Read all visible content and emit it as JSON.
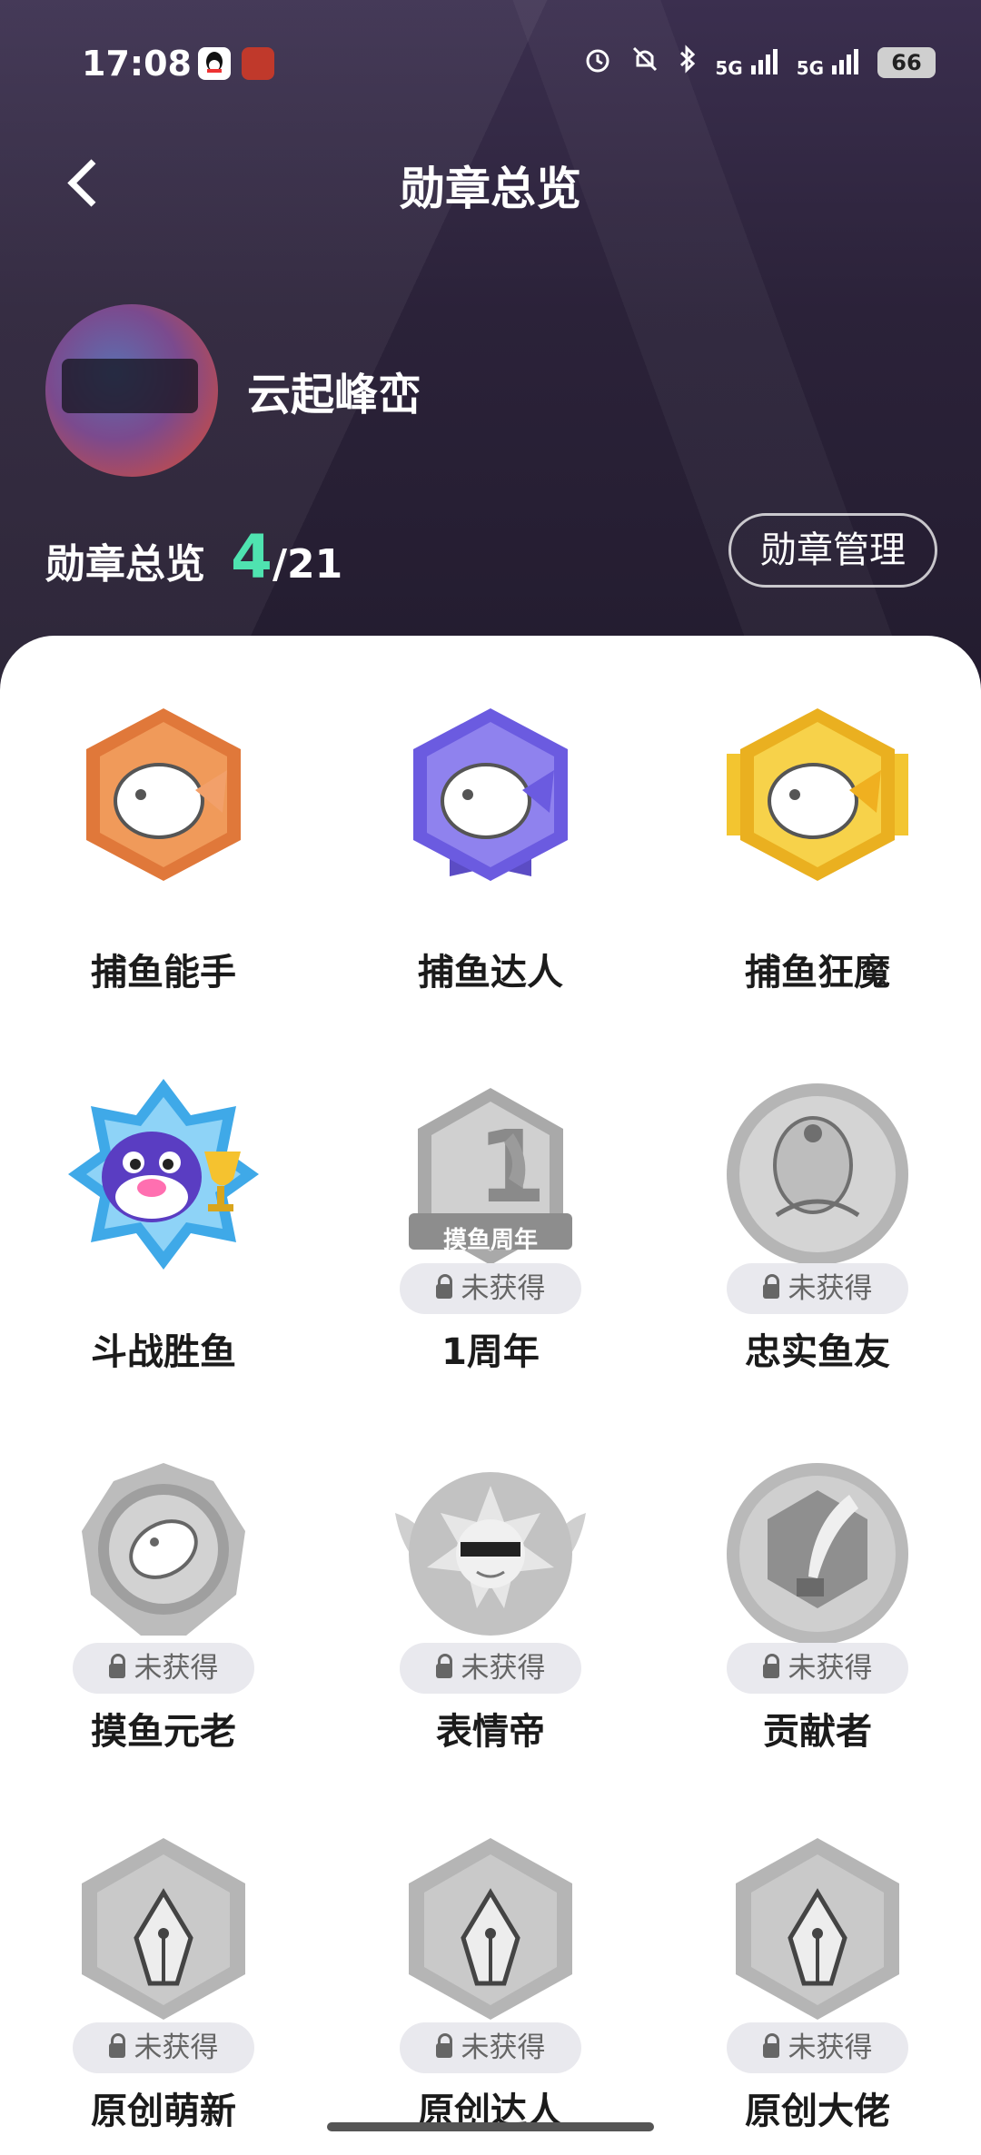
{
  "status_bar": {
    "time": "17:08",
    "icons": [
      "qq-icon",
      "game-avatar-icon",
      "alarm-icon",
      "mute-icon",
      "bluetooth-icon",
      "signal-5g-icon",
      "signal-5g-icon"
    ],
    "signal1": "5G",
    "signal2": "5G",
    "battery": "66"
  },
  "nav": {
    "back_icon": "chevron-left-icon",
    "title": "勋章总览"
  },
  "profile": {
    "username": "云起峰峦"
  },
  "summary": {
    "label": "勋章总览",
    "earned": "4",
    "total": "/21",
    "manage_label": "勋章管理"
  },
  "colors": {
    "accent_green": "#4fe3b0",
    "header_bg": "#2b2239",
    "locked_gray": "#9a9a9a"
  },
  "badges": [
    {
      "name": "捕鱼能手",
      "locked": false,
      "color": "#e58a4a",
      "icon": "fish-bronze-badge-icon"
    },
    {
      "name": "捕鱼达人",
      "locked": false,
      "color": "#7d6fe0",
      "icon": "fish-purple-badge-icon"
    },
    {
      "name": "捕鱼狂魔",
      "locked": false,
      "color": "#f0b92a",
      "icon": "fish-gold-badge-icon"
    },
    {
      "name": "斗战胜鱼",
      "locked": false,
      "color": "#3fa9e8",
      "icon": "pufferfish-trophy-badge-icon"
    },
    {
      "name": "1周年",
      "locked": true,
      "lock_text": "未获得",
      "icon": "anniversary-badge-icon",
      "badge_text": "摸鱼周年"
    },
    {
      "name": "忠实鱼友",
      "locked": true,
      "lock_text": "未获得",
      "icon": "loyal-fish-badge-icon"
    },
    {
      "name": "摸鱼元老",
      "locked": true,
      "lock_text": "未获得",
      "icon": "veteran-fish-badge-icon"
    },
    {
      "name": "表情帝",
      "locked": true,
      "lock_text": "未获得",
      "icon": "emoji-sun-badge-icon"
    },
    {
      "name": "贡献者",
      "locked": true,
      "lock_text": "未获得",
      "icon": "quill-badge-icon"
    },
    {
      "name": "原创萌新",
      "locked": true,
      "lock_text": "未获得",
      "icon": "pen-nib-badge-icon"
    },
    {
      "name": "原创达人",
      "locked": true,
      "lock_text": "未获得",
      "icon": "pen-nib-badge-icon"
    },
    {
      "name": "原创大佬",
      "locked": true,
      "lock_text": "未获得",
      "icon": "pen-nib-badge-icon"
    }
  ]
}
